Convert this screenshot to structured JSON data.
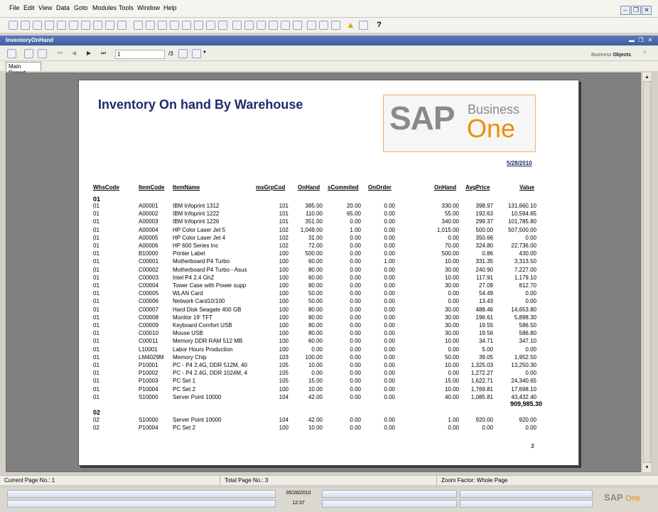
{
  "menu": {
    "items": [
      "File",
      "Edit",
      "View",
      "Data",
      "Goto",
      "Modules",
      "Tools",
      "Window",
      "Help"
    ]
  },
  "window": {
    "title": "InventoryOnHand",
    "controls": [
      "minimize-icon",
      "restore-icon",
      "close-icon"
    ]
  },
  "viewer_toolbar": {
    "page_input_value": "1",
    "page_total": "/3",
    "brand_line1": "Business",
    "brand_line2": "Objects"
  },
  "tabs": [
    "Main Report"
  ],
  "report": {
    "title": "Inventory On hand By Warehouse",
    "logo_sap": "SAP",
    "logo_business": "Business",
    "logo_one": "One",
    "date": "5/28/2010",
    "headers": {
      "whscode": "WhsCode",
      "itemcode": "ItemCode",
      "itemname": "ItemName",
      "msgrpcod": "msGrpCod",
      "onhand1": "OnHand",
      "commited": "sCommited",
      "onorder": "OnOrder",
      "onhand2": "OnHand",
      "avgprice": "AvgPrice",
      "value": "Value"
    },
    "groups": [
      {
        "name": "01",
        "rows": [
          [
            "01",
            "A00001",
            "IBM Infoprint 1312",
            "101",
            "385.00",
            "20.00",
            "0.00",
            "330.00",
            "398.97",
            "131,660.10"
          ],
          [
            "01",
            "A00002",
            "IBM Infoprint 1222",
            "101",
            "110.00",
            "65.00",
            "0.00",
            "55.00",
            "192.63",
            "10,594.65"
          ],
          [
            "01",
            "A00003",
            "IBM Infoprint 1226",
            "101",
            "351.00",
            "0.00",
            "0.00",
            "340.00",
            "299.37",
            "101,785.80"
          ],
          [
            "01",
            "A00004",
            "HP Color Laser Jet 5",
            "102",
            "1,049.00",
            "1.00",
            "0.00",
            "1,015.00",
            "500.00",
            "507,500.00"
          ],
          [
            "01",
            "A00005",
            "HP Color Laser Jet 4",
            "102",
            "31.00",
            "0.00",
            "0.00",
            "0.00",
            "350.66",
            "0.00"
          ],
          [
            "01",
            "A00006",
            "HP 600 Series Inc",
            "102",
            "72.00",
            "0.00",
            "0.00",
            "70.00",
            "324.80",
            "22,736.00"
          ],
          [
            "01",
            "B10000",
            "Printer Label",
            "100",
            "500.00",
            "0.00",
            "0.00",
            "500.00",
            "0.86",
            "430.00"
          ],
          [
            "01",
            "C00001",
            "Motherboard P4 Turbo",
            "100",
            "60.00",
            "0.00",
            "1.00",
            "10.00",
            "331.35",
            "3,313.50"
          ],
          [
            "01",
            "C00002",
            "Motherboard P4 Turbo - Asus",
            "100",
            "80.00",
            "0.00",
            "0.00",
            "30.00",
            "240.90",
            "7,227.00"
          ],
          [
            "01",
            "C00003",
            "Intel P4 2.4 GhZ",
            "100",
            "60.00",
            "0.00",
            "0.00",
            "10.00",
            "117.91",
            "1,179.10"
          ],
          [
            "01",
            "C00004",
            "Tower Case with Power supp",
            "100",
            "80.00",
            "0.00",
            "0.00",
            "30.00",
            "27.09",
            "812.70"
          ],
          [
            "01",
            "C00005",
            "WLAN Card",
            "100",
            "50.00",
            "0.00",
            "0.00",
            "0.00",
            "54.49",
            "0.00"
          ],
          [
            "01",
            "C00006",
            "Network Card10/100",
            "100",
            "50.00",
            "0.00",
            "0.00",
            "0.00",
            "13.43",
            "0.00"
          ],
          [
            "01",
            "C00007",
            "Hard Disk Seagate 400 GB",
            "100",
            "80.00",
            "0.00",
            "0.00",
            "30.00",
            "488.46",
            "14,653.80"
          ],
          [
            "01",
            "C00008",
            "Monitor 19' TFT",
            "100",
            "80.00",
            "0.00",
            "0.00",
            "30.00",
            "196.61",
            "5,898.30"
          ],
          [
            "01",
            "C00009",
            "Keyboard Comfort USB",
            "100",
            "80.00",
            "0.00",
            "0.00",
            "30.00",
            "19.55",
            "586.50"
          ],
          [
            "01",
            "C00010",
            "Mouse USB",
            "100",
            "80.00",
            "0.00",
            "0.00",
            "30.00",
            "19.56",
            "586.80"
          ],
          [
            "01",
            "C00011",
            "Memory DDR RAM 512 MB",
            "100",
            "60.00",
            "0.00",
            "0.00",
            "10.00",
            "34.71",
            "347.10"
          ],
          [
            "01",
            "L10001",
            "Labor Hours Production",
            "100",
            "0.00",
            "0.00",
            "0.00",
            "0.00",
            "5.00",
            "0.00"
          ],
          [
            "01",
            "LM4029M",
            "Memory Chip",
            "103",
            "100.00",
            "0.00",
            "0.00",
            "50.00",
            "39.05",
            "1,952.50"
          ],
          [
            "01",
            "P10001",
            "PC - P4 2.4G, DDR 512M, 40",
            "105",
            "10.00",
            "0.00",
            "0.00",
            "10.00",
            "1,325.03",
            "13,250.30"
          ],
          [
            "01",
            "P10002",
            "PC - P4 2.4G, DDR 1024M, 4",
            "105",
            "0.00",
            "0.00",
            "0.00",
            "0.00",
            "1,272.27",
            "0.00"
          ],
          [
            "01",
            "P10003",
            "PC Set 1",
            "105",
            "15.00",
            "0.00",
            "0.00",
            "15.00",
            "1,622.71",
            "24,340.65"
          ],
          [
            "01",
            "P10004",
            "PC Set 2",
            "100",
            "10.00",
            "0.00",
            "0.00",
            "10.00",
            "1,769.81",
            "17,698.10"
          ],
          [
            "01",
            "S10000",
            "Server Point 10000",
            "104",
            "42.00",
            "0.00",
            "0.00",
            "40.00",
            "1,085.81",
            "43,432.40"
          ]
        ],
        "total": "909,985.30"
      },
      {
        "name": "02",
        "rows": [
          [
            "02",
            "S10000",
            "Server Point 10000",
            "104",
            "42.00",
            "0.00",
            "0.00",
            "1.00",
            "920.00",
            "920.00"
          ],
          [
            "02",
            "P10004",
            "PC Set 2",
            "100",
            "10.00",
            "0.00",
            "0.00",
            "0.00",
            "0.00",
            "0.00"
          ]
        ]
      }
    ],
    "page_number": "3"
  },
  "status": {
    "current_page": "Current Page No.: 1",
    "total_page": "Total Page No.: 3",
    "zoom": "Zoom Factor: Whole Page"
  },
  "footer": {
    "date": "05/28/2010",
    "time": "12:37",
    "brand_sap": "SAP",
    "brand_business": "Business",
    "brand_one": "One"
  }
}
